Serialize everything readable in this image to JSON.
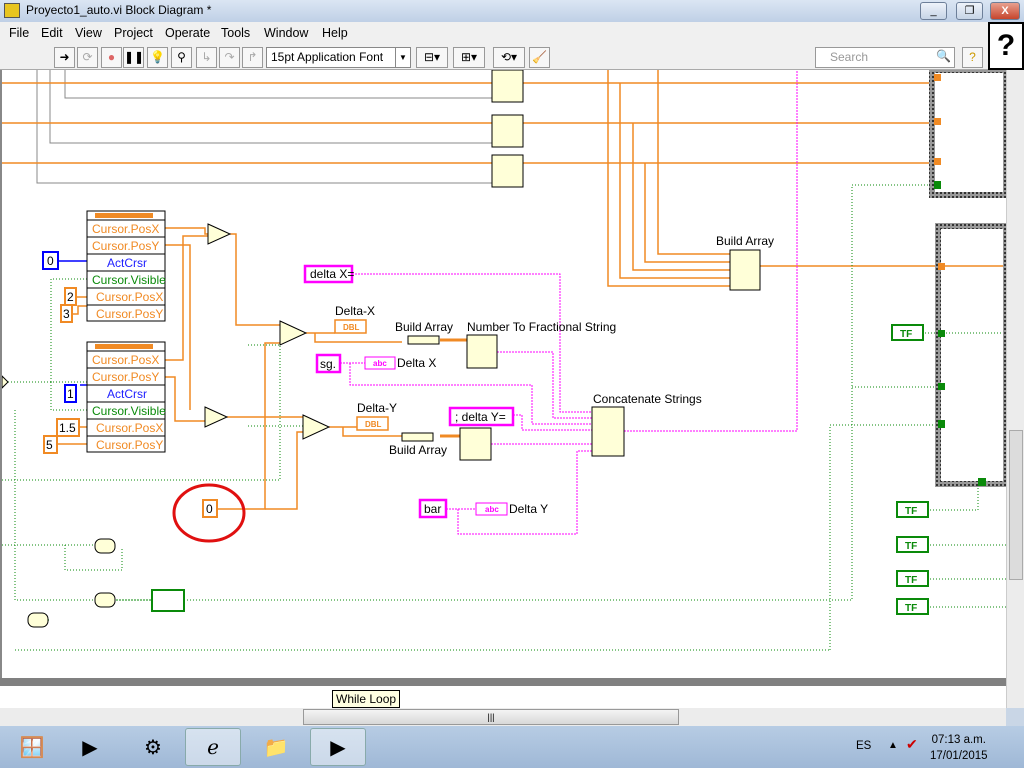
{
  "window": {
    "title": "Proyecto1_auto.vi Block Diagram *",
    "min": "_",
    "restore": "❐",
    "close": "X"
  },
  "menu": [
    "File",
    "Edit",
    "View",
    "Project",
    "Operate",
    "Tools",
    "Window",
    "Help"
  ],
  "toolbar": {
    "font": "15pt Application Font",
    "search_placeholder": "Search",
    "help": "?"
  },
  "diagram": {
    "property_node_1": [
      "Cursor.PosX",
      "Cursor.PosY",
      "ActCrsr",
      "Cursor.Visible",
      "Cursor.PosX",
      "Cursor.PosY"
    ],
    "property_node_2": [
      "Cursor.PosX",
      "Cursor.PosY",
      "ActCrsr",
      "Cursor.Visible",
      "Cursor.PosX",
      "Cursor.PosY"
    ],
    "constants": {
      "c0": "0",
      "c2": "2",
      "c3": "3",
      "c1": "1",
      "c15": "1.5",
      "c5": "5",
      "zero": "0"
    },
    "delta_x_label": "Delta-X",
    "delta_y_label": "Delta-Y",
    "dbl": "DBL",
    "build_array_1": "Build Array",
    "build_array_2": "Build Array",
    "build_array_top": "Build Array",
    "num_to_frac": "Number To Fractional String",
    "concat": "Concatenate Strings",
    "str_delta_x": "delta X=",
    "str_sg": "sg.",
    "str_delta_y": ";  delta Y=",
    "str_bar": "bar",
    "ind_delta_x": "Delta X",
    "ind_delta_y": "Delta Y",
    "abc": "abc",
    "tf": "TF",
    "colors": {
      "numeric": "#ff7f00",
      "string": "#ff00ff",
      "boolean": "#008000",
      "int": "#0000ff"
    }
  },
  "tooltip": "While Loop",
  "taskbar": {
    "lang": "ES",
    "time": "07:13 a.m.",
    "date": "17/01/2015"
  }
}
